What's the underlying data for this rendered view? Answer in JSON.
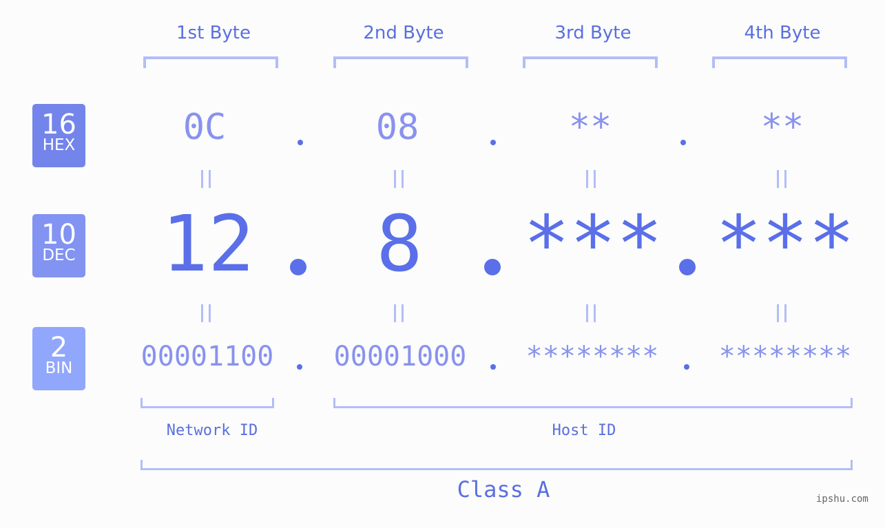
{
  "colors": {
    "accent": "#5a6fe8",
    "light_value": "#8892ef",
    "bracket": "#b3bdf7",
    "badge_hex": "#7384ea",
    "badge_dec": "#8293f2",
    "badge_bin": "#90a7fb",
    "watermark": "#666666"
  },
  "byte_headers": [
    "1st Byte",
    "2nd Byte",
    "3rd Byte",
    "4th Byte"
  ],
  "badges": [
    {
      "number": "16",
      "label": "HEX"
    },
    {
      "number": "10",
      "label": "DEC"
    },
    {
      "number": "2",
      "label": "BIN"
    }
  ],
  "hex": [
    "0C",
    "08",
    "**",
    "**"
  ],
  "dec": [
    "12",
    "8",
    "***",
    "***"
  ],
  "bin": [
    "00001100",
    "00001000",
    "********",
    "********"
  ],
  "separator": ".",
  "equals_glyph": "||",
  "network_id_label": "Network ID",
  "host_id_label": "Host ID",
  "class_label": "Class A",
  "watermark": "ipshu.com"
}
